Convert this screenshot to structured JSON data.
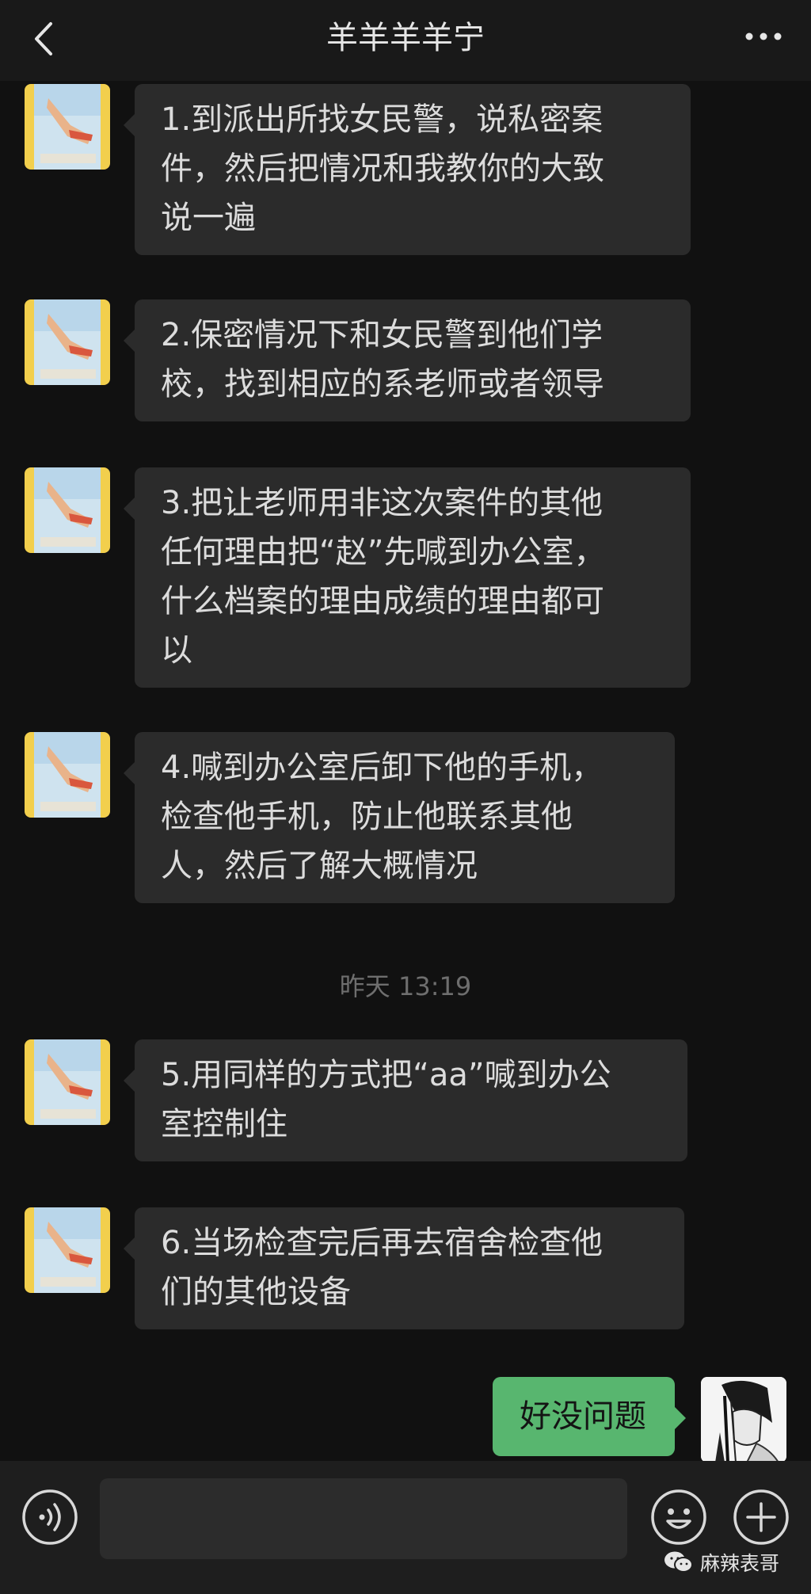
{
  "header": {
    "title": "羊羊羊羊宁"
  },
  "messages": [
    {
      "text_lines": [
        "1.到派出所找女民警，说私密案",
        "件，然后把情况和我教你的大致",
        "说一遍"
      ]
    },
    {
      "text_lines": [
        "2.保密情况下和女民警到他们学",
        "校，找到相应的系老师或者领导"
      ]
    },
    {
      "text_lines": [
        "3.把让老师用非这次案件的其他",
        "任何理由把“赵”先喊到办公室，",
        "什么档案的理由成绩的理由都可",
        "以"
      ]
    },
    {
      "text_lines": [
        "4.喊到办公室后卸下他的手机，",
        "检查他手机，防止他联系其他",
        "人，然后了解大概情况"
      ]
    },
    {
      "text_lines": [
        "5.用同样的方式把“aa”喊到办公",
        "室控制住"
      ]
    },
    {
      "text_lines": [
        "6.当场检查完后再去宿舍检查他",
        "们的其他设备"
      ]
    }
  ],
  "timestamp": "昨天 13:19",
  "my_message": "好没问题",
  "watermark": "麻辣表哥",
  "colors": {
    "background": "#111111",
    "incoming_bubble": "#2b2b2b",
    "outgoing_bubble": "#58b66f"
  },
  "icons": {
    "back": "chevron-left-icon",
    "more": "more-dots-icon",
    "voice": "voice-icon",
    "emoji": "emoji-icon",
    "plus": "plus-icon",
    "watermark": "wechat-icon"
  }
}
